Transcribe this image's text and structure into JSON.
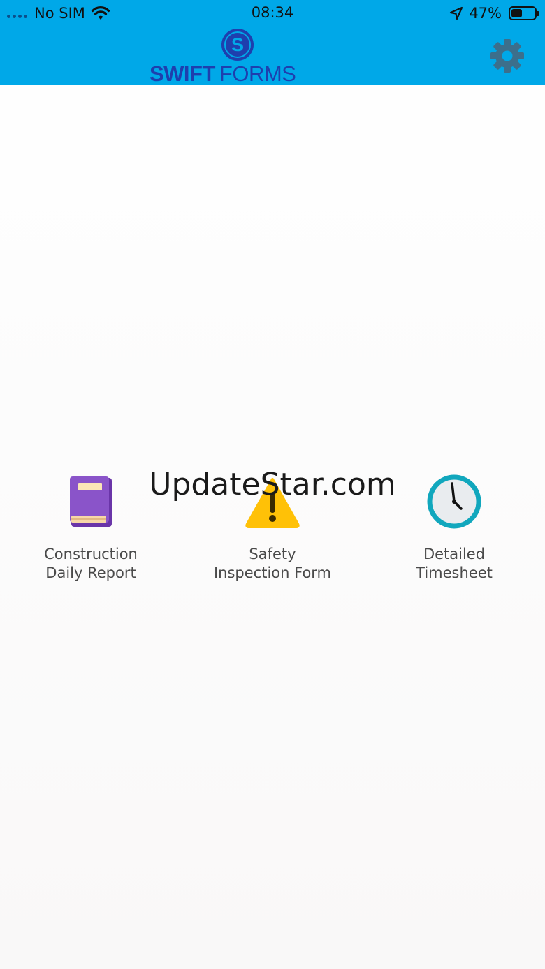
{
  "status_bar": {
    "carrier": "No SIM",
    "time": "08:34",
    "battery": "47%",
    "battery_level": 0.47,
    "icons": [
      "signal-dots-icon",
      "wifi-icon",
      "location-arrow-icon",
      "battery-icon"
    ]
  },
  "header": {
    "logo_mark": "S",
    "logo_word_bold": "SWIFT",
    "logo_word_light": "FORMS",
    "settings_icon": "gear-icon",
    "colors": {
      "bar": "#00a8e8",
      "logo": "#1e3fae",
      "gear": "#3c6f8c"
    }
  },
  "forms": [
    {
      "label": "Construction\nDaily Report",
      "icon": "book-icon"
    },
    {
      "label": "Safety\nInspection Form",
      "icon": "warning-icon"
    },
    {
      "label": "Detailed\nTimesheet",
      "icon": "clock-icon"
    }
  ],
  "watermark": "UpdateStar.com"
}
